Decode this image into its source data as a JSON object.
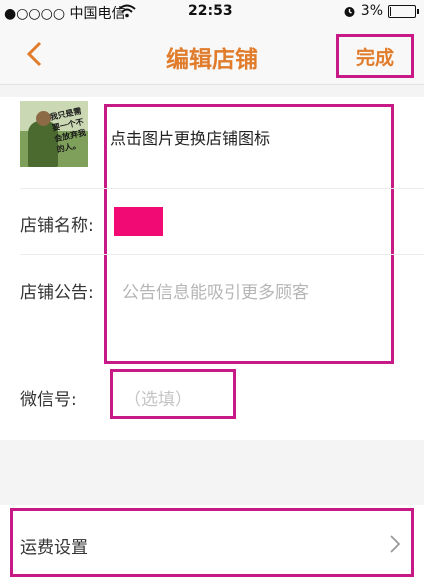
{
  "status_bar": {
    "carrier": "●○○○○ 中国电信",
    "time": "22:53",
    "battery": "3%",
    "wifi_icon": "wifi-icon",
    "alarm_icon": "alarm-icon"
  },
  "nav": {
    "title": "编辑店铺",
    "done_label": "完成",
    "back_icon": "chevron-left-icon"
  },
  "logo": {
    "caption": "我只是需要一个不会放弃我的人。",
    "hint": "点击图片更换店铺图标"
  },
  "fields": {
    "name_label": "店铺名称:",
    "notice_label": "店铺公告:",
    "notice_placeholder": "公告信息能吸引更多顾客",
    "wechat_label": "微信号:",
    "wechat_placeholder": "（选填）"
  },
  "shipping": {
    "label": "运费设置",
    "chevron_icon": "chevron-right-icon"
  },
  "colors": {
    "accent": "#e07c2b",
    "annotation": "#c81a87",
    "name_highlight": "#f10a73"
  }
}
